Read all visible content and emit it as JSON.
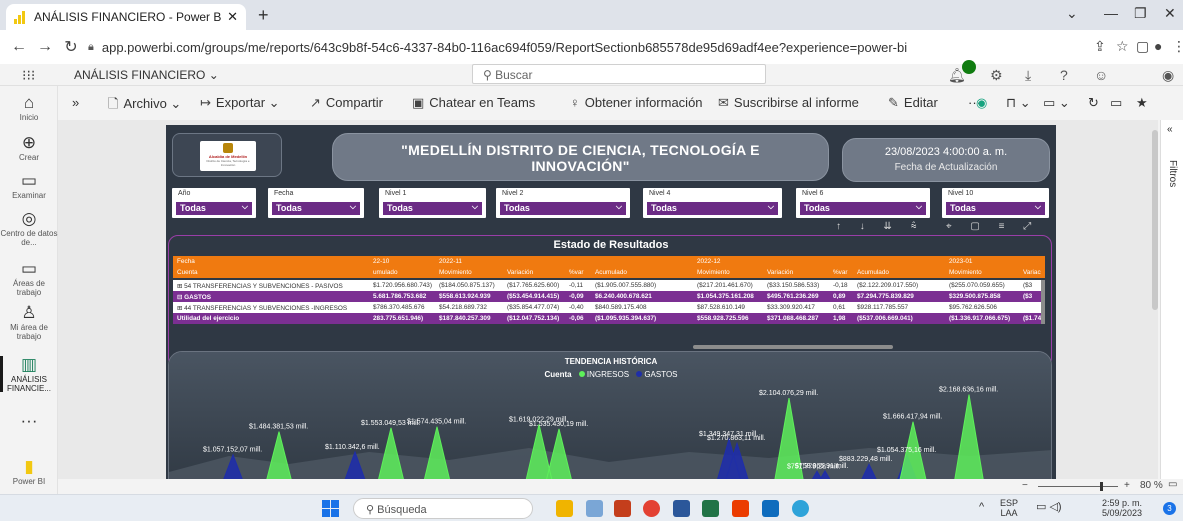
{
  "browser": {
    "tab_title": "ANÁLISIS FINANCIERO - Power BI",
    "url": "app.powerbi.com/groups/me/reports/643c9b8f-54c6-4337-84b0-116ac694f059/ReportSectionb685578de95d69adf4ee?experience=power-bi"
  },
  "pbi": {
    "app_name": "ANÁLISIS FINANCIERO",
    "search_placeholder": "Buscar"
  },
  "rail": [
    {
      "label": "Inicio",
      "icon": "home-icon"
    },
    {
      "label": "Crear",
      "icon": "plus-circle-icon"
    },
    {
      "label": "Examinar",
      "icon": "folder-icon"
    },
    {
      "label": "Centro de datos de...",
      "icon": "data-hub-icon"
    },
    {
      "label": "Áreas de trabajo",
      "icon": "workspaces-icon"
    },
    {
      "label": "Mi área de trabajo",
      "icon": "person-icon"
    },
    {
      "label": "ANÁLISIS FINANCIE...",
      "icon": "report-icon"
    },
    {
      "label": "Power BI",
      "icon": "powerbi-logo-icon"
    }
  ],
  "toolbar": {
    "archivo": "Archivo",
    "exportar": "Exportar",
    "compartir": "Compartir",
    "teams": "Chatear en Teams",
    "insights": "Obtener información",
    "suscribirse": "Suscribirse al informe",
    "editar": "Editar",
    "more": "···"
  },
  "report": {
    "logo_text": "Alcaldía de Medellín",
    "logo_sub": "Distrito de Ciencia, Tecnología e Innovación",
    "title_line1": "\"MEDELLÍN DISTRITO DE CIENCIA, TECNOLOGÍA E",
    "title_line2": "INNOVACIÓN\"",
    "update_date": "23/08/2023 4:00:00 a. m.",
    "update_label": "Fecha de Actualización",
    "slicers": [
      {
        "label": "Año",
        "value": "Todas"
      },
      {
        "label": "Fecha",
        "value": "Todas"
      },
      {
        "label": "Nivel 1",
        "value": "Todas"
      },
      {
        "label": "Nivel 2",
        "value": "Todas"
      },
      {
        "label": "Nivel 4",
        "value": "Todas"
      },
      {
        "label": "Nivel 6",
        "value": "Todas"
      },
      {
        "label": "Nivel 10",
        "value": "Todas"
      }
    ]
  },
  "estado": {
    "title": "Estado de Resultados",
    "h1": {
      "c0": "Fecha",
      "c1": "22-10",
      "c2": "2022-11",
      "c3": "2022-12",
      "c4": "2023-01"
    },
    "h2": {
      "c0": "Cuenta",
      "c1": "umulado",
      "c2": "Movimiento",
      "c3": "Variación",
      "c4": "%var",
      "c5": "Acumulado",
      "c6": "Movimiento",
      "c7": "Variación",
      "c8": "%var",
      "c9": "Acumulado",
      "c10": "Movimiento",
      "c11": "Variac"
    },
    "rows": [
      {
        "c0": "⊞  54 TRANSFERENCIAS Y SUBVENCIONES - PASIVOS",
        "c1": "$1.720.956.680.743)",
        "c2": "($184.050.875.137)",
        "c3": "($17.765.625.600)",
        "c4": "-0,11",
        "c5": "($1.905.007.555.880)",
        "c6": "($217.201.461.670)",
        "c7": "($33.150.586.533)",
        "c8": "-0,18",
        "c9": "($2.122.209.017.550)",
        "c10": "($255.070.059.655)",
        "c11": "($3"
      },
      {
        "c0": "⊟  GASTOS",
        "c1": "5.681.786.753.682",
        "c2": "$558.613.924.939",
        "c3": "($53.454.914.415)",
        "c4": "-0,09",
        "c5": "$6.240.400.678.621",
        "c6": "$1.054.375.161.208",
        "c7": "$495.761.236.269",
        "c8": "0,89",
        "c9": "$7.294.775.839.829",
        "c10": "$329.500.875.858",
        "c11": "($3"
      },
      {
        "c0": "⊞  44 TRANSFERENCIAS Y SUBVENCIONES -INGRESOS",
        "c1": "$786.370.485.676",
        "c2": "$54.218.689.732",
        "c3": "($35.854.477.074)",
        "c4": "-0,40",
        "c5": "$840.589.175.408",
        "c6": "$87.528.610.149",
        "c7": "$33.309.920.417",
        "c8": "0,61",
        "c9": "$928.117.785.557",
        "c10": "$95.762.626.506",
        "c11": ""
      },
      {
        "c0": "Utilidad del ejercicio",
        "c1": "283.775.651.946)",
        "c2": "$187.840.257.309",
        "c3": "($12.047.752.134)",
        "c4": "-0,06",
        "c5": "($1.095.935.394.637)",
        "c6": "$558.928.725.596",
        "c7": "$371.088.468.287",
        "c8": "1,98",
        "c9": "($537.006.669.041)",
        "c10": "($1.336.917.066.675)",
        "c11": "($1.74"
      }
    ]
  },
  "chart_data": {
    "type": "area",
    "title": "TENDENCIA HISTÓRICA",
    "legend_title": "Cuenta",
    "legend_placement": "top-center",
    "series": [
      {
        "name": "INGRESOS",
        "color": "#5ef05a",
        "labels": [
          "$1.484.381,53 mill.",
          "$1.553.049,53 mill.",
          "$1.574.435,04 mill.",
          "$1.535.430,19 mill.",
          "$1.619.022,29 mill.",
          "$2.104.076,29 mill.",
          "$1.666.417,94 mill.",
          "$2.168.636,16 mill."
        ]
      },
      {
        "name": "GASTOS",
        "color": "#1f2ea8",
        "labels": [
          "$1.057.152,07 mill.",
          "$1.110.342,6 mill.",
          "$1.270.863,11 mill.",
          "$1.349.347,31 mill.",
          "$751.779,28 mill.",
          "$883.229,48 mill.",
          "$1.054.375,16 mill.",
          "$758.865,91 mill."
        ]
      }
    ],
    "other_labels": [
      "$581.762,48 mill.",
      "$540.434,31 mill.",
      "$607.731,24 mill.",
      "$558.613,92 mill."
    ]
  },
  "status": {
    "zoom": "80 %"
  },
  "taskbar": {
    "search": "Búsqueda",
    "lang1": "ESP",
    "lang2": "LAA",
    "time": "2:59 p. m.",
    "date": "5/09/2023"
  }
}
